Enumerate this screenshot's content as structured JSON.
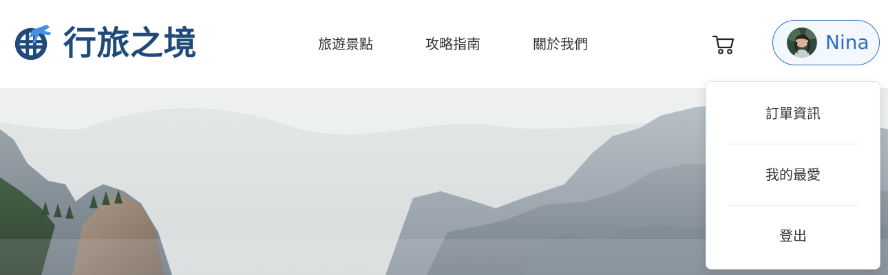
{
  "brand": {
    "name": "行旅之境",
    "colors": {
      "primary": "#1f4a7a",
      "accent": "#2a6fbf"
    },
    "logo_icon": "globe-plane-logo"
  },
  "nav": {
    "items": [
      {
        "label": "旅遊景點"
      },
      {
        "label": "攻略指南"
      },
      {
        "label": "關於我們"
      }
    ]
  },
  "cart": {
    "icon": "shopping-cart-icon"
  },
  "user": {
    "name": "Nina",
    "avatar_icon": "user-avatar"
  },
  "dropdown": {
    "items": [
      {
        "label": "訂單資訊"
      },
      {
        "label": "我的最愛"
      },
      {
        "label": "登出"
      }
    ]
  },
  "hero": {
    "image": "mountain-landscape"
  }
}
